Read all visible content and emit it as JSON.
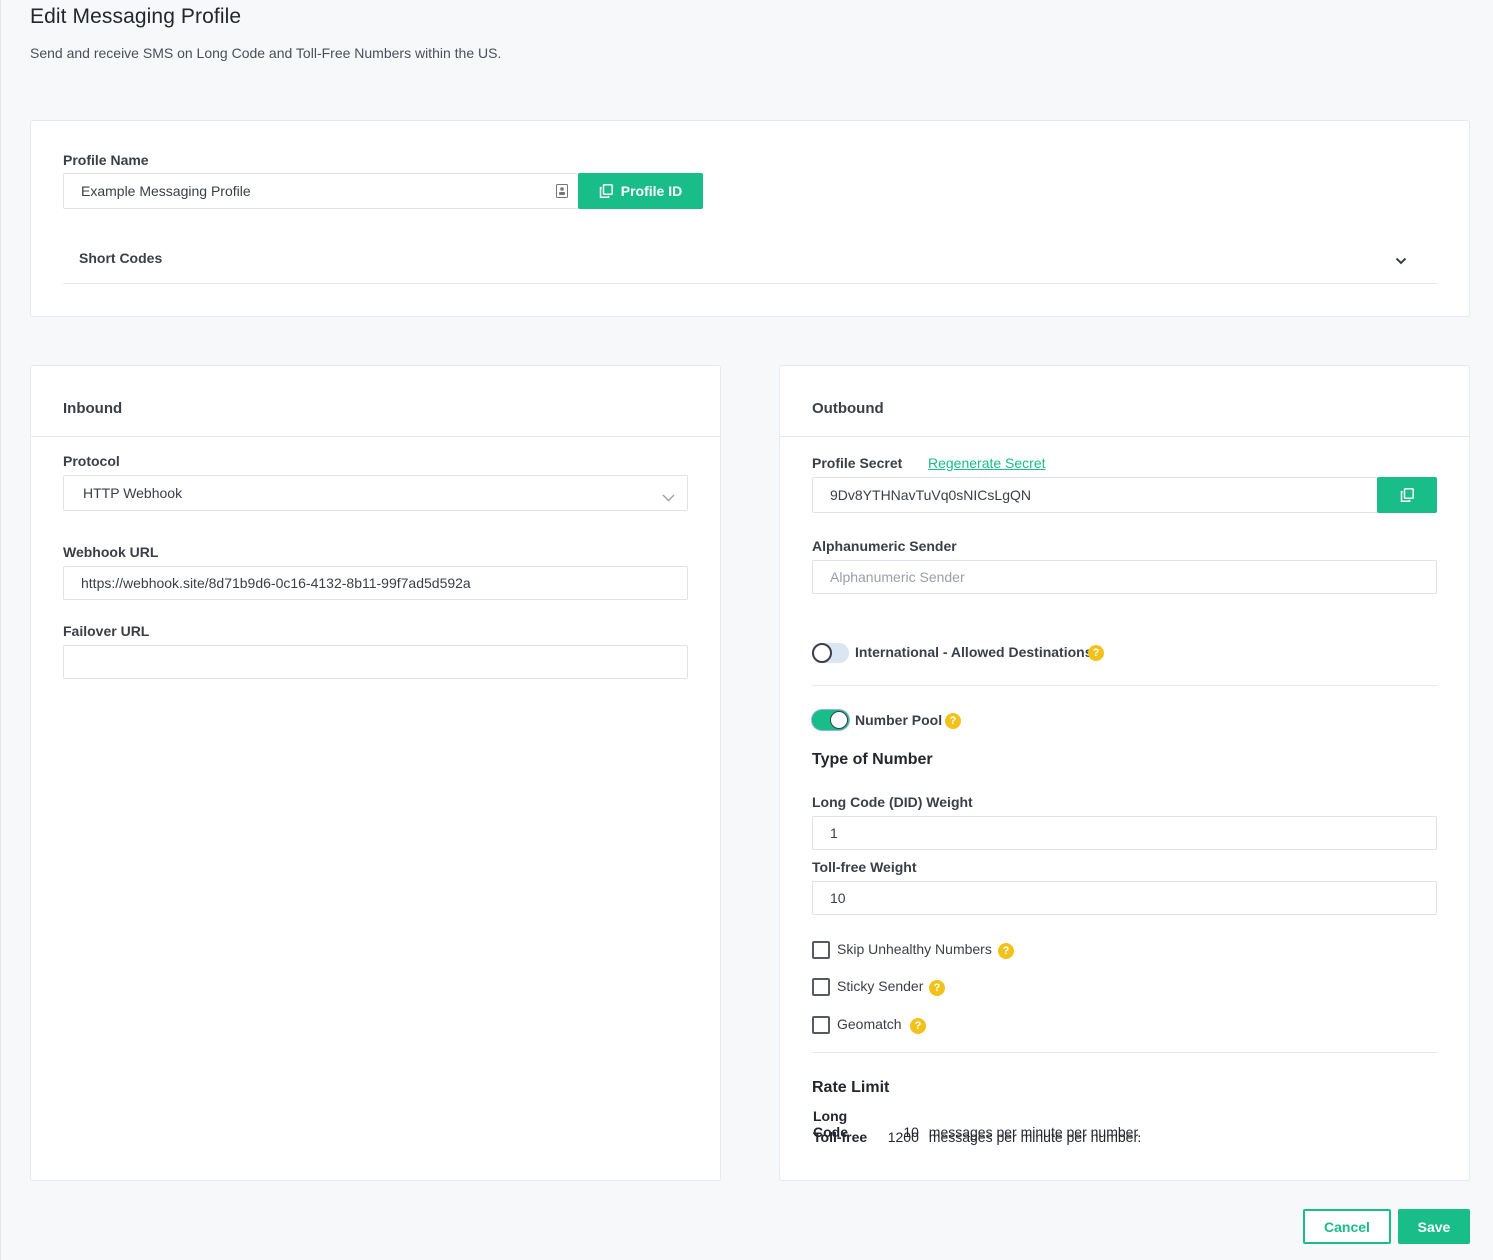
{
  "page": {
    "title": "Edit Messaging Profile",
    "subtitle": "Send and receive SMS on Long Code and Toll-Free Numbers within the US."
  },
  "profile": {
    "name_label": "Profile Name",
    "name_value": "Example Messaging Profile",
    "profile_id_button": "Profile ID",
    "short_codes_label": "Short Codes"
  },
  "inbound": {
    "title": "Inbound",
    "protocol_label": "Protocol",
    "protocol_value": "HTTP Webhook",
    "webhook_url_label": "Webhook URL",
    "webhook_url_value": "https://webhook.site/8d71b9d6-0c16-4132-8b11-99f7ad5d592a",
    "failover_url_label": "Failover URL",
    "failover_url_value": ""
  },
  "outbound": {
    "title": "Outbound",
    "profile_secret_label": "Profile Secret",
    "regenerate_secret_link": "Regenerate Secret",
    "profile_secret_value": "9Dv8YTHNavTuVq0sNICsLgQN",
    "alphanumeric_sender_label": "Alphanumeric Sender",
    "alphanumeric_sender_placeholder": "Alphanumeric Sender",
    "international_label": "International - Allowed Destinations",
    "international_enabled": false,
    "number_pool_label": "Number Pool",
    "number_pool_enabled": true,
    "type_of_number_title": "Type of Number",
    "long_code_weight_label": "Long Code (DID) Weight",
    "long_code_weight_value": "1",
    "toll_free_weight_label": "Toll-free Weight",
    "toll_free_weight_value": "10",
    "skip_unhealthy_label": "Skip Unhealthy Numbers",
    "skip_unhealthy_checked": false,
    "sticky_sender_label": "Sticky Sender",
    "sticky_sender_checked": false,
    "geomatch_label": "Geomatch",
    "geomatch_checked": false,
    "rate_limit_title": "Rate Limit",
    "rate_limits": [
      {
        "type": "Long Code",
        "value": "10",
        "unit": "messages per minute per number."
      },
      {
        "type": "Toll-free",
        "value": "1200",
        "unit": "messages per minute per number."
      }
    ]
  },
  "actions": {
    "cancel": "Cancel",
    "save": "Save"
  },
  "colors": {
    "accent": "#19bd88",
    "help": "#f3c21a"
  },
  "icons": {
    "copy": "copy-icon",
    "chevron": "chevron-down-icon",
    "help": "help-icon",
    "contact_card": "contact-card-icon"
  }
}
